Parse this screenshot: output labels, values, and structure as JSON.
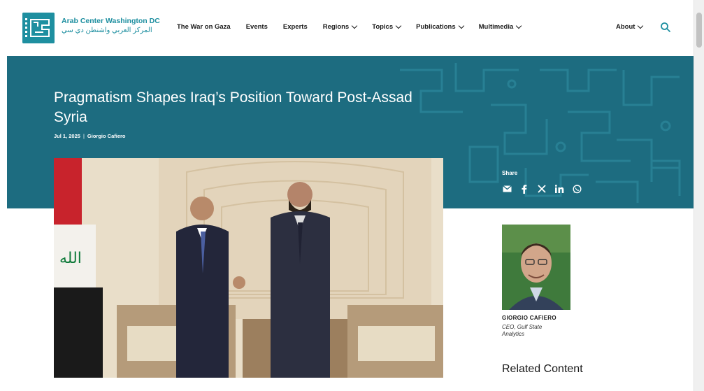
{
  "header": {
    "logo_en": "Arab Center Washington DC",
    "logo_ar": "المركز العربي واشنطن دي سي",
    "nav": [
      {
        "label": "The War on Gaza",
        "dropdown": false
      },
      {
        "label": "Events",
        "dropdown": false
      },
      {
        "label": "Experts",
        "dropdown": false
      },
      {
        "label": "Regions",
        "dropdown": true
      },
      {
        "label": "Topics",
        "dropdown": true
      },
      {
        "label": "Publications",
        "dropdown": true
      },
      {
        "label": "Multimedia",
        "dropdown": true
      }
    ],
    "about_label": "About",
    "search_icon": "search-icon"
  },
  "article": {
    "title": "Pragmatism Shapes Iraq’s Position Toward Post-Assad Syria",
    "date": "Jul 1, 2025",
    "separator": "|",
    "author": "Giorgio Cafiero"
  },
  "share": {
    "label": "Share",
    "icons": [
      "email-icon",
      "facebook-icon",
      "x-icon",
      "linkedin-icon",
      "whatsapp-icon"
    ]
  },
  "author_card": {
    "name": "GIORGIO CAFIERO",
    "role": "CEO, Gulf State Analytics"
  },
  "related": {
    "heading": "Related Content"
  },
  "colors": {
    "brand_teal": "#1e8fa0",
    "hero_bg": "#1d6c80"
  }
}
